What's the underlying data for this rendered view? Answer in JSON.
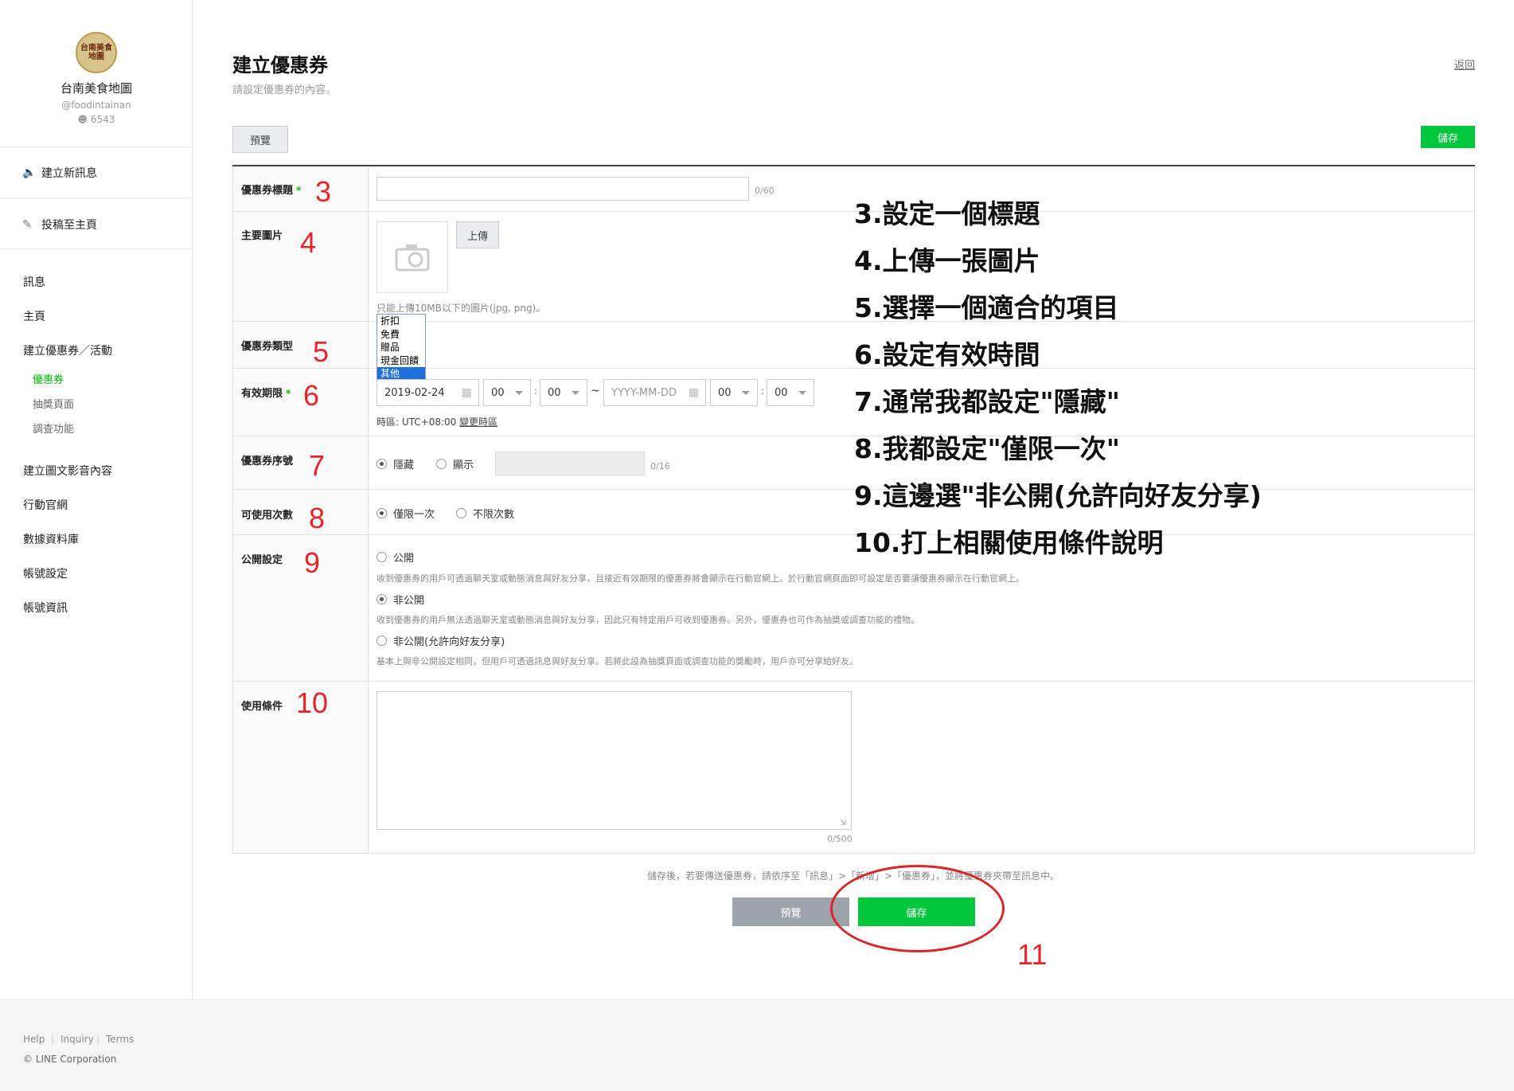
{
  "sidebar": {
    "account_logo_text": "台南美食地圖",
    "account_name": "台南美食地圖",
    "account_id": "@foodintainan",
    "followers": "6543",
    "actions": [
      {
        "label": "建立新訊息",
        "icon": "megaphone-icon"
      },
      {
        "label": "投稿至主頁",
        "icon": "edit-icon"
      }
    ],
    "menu": {
      "messages": "訊息",
      "home": "主頁",
      "coupon_event": "建立優惠券／活動",
      "coupon": "優惠券",
      "lottery": "抽獎頁面",
      "survey": "調查功能",
      "rich_content": "建立圖文影音內容",
      "official_site": "行動官網",
      "database": "數據資料庫",
      "account_settings": "帳號設定",
      "account_info": "帳號資訊"
    }
  },
  "header": {
    "title": "建立優惠券",
    "subtitle": "請設定優惠券的內容。",
    "back": "返回",
    "preview": "預覽",
    "save": "儲存"
  },
  "form": {
    "title_label": "優惠券標題",
    "required_mark": "*",
    "title_counter": "0/60",
    "image_label": "主要圖片",
    "upload": "上傳",
    "image_hint": "只能上傳10MB以下的圖片(jpg, png)。",
    "type_label": "優惠券類型",
    "type_options": [
      "折扣",
      "免費",
      "贈品",
      "現金回饋",
      "其他"
    ],
    "type_selected": "其他",
    "period_label": "有效期限",
    "start_date": "2019-02-24",
    "start_hour": "00",
    "start_min": "00",
    "tilde": "~",
    "colon": ":",
    "end_date_placeholder": "YYYY-MM-DD",
    "end_hour": "00",
    "end_min": "00",
    "timezone": "時區: UTC+08:00",
    "change_timezone": "變更時區",
    "serial_label": "優惠券序號",
    "serial_hide": "隱藏",
    "serial_show": "顯示",
    "serial_counter": "0/16",
    "usage_label": "可使用次數",
    "usage_once": "僅限一次",
    "usage_unlimited": "不限次數",
    "public_label": "公開設定",
    "public": "公開",
    "public_desc": "收到優惠券的用戶可透過聊天室或動態消息與好友分享，且接近有效期限的優惠券將會顯示在行動官網上。於行動官網頁面即可設定是否要讓優惠券顯示在行動官網上。",
    "private": "非公開",
    "private_desc": "收到優惠券的用戶無法透過聊天室或動態消息與好友分享，因此只有特定用戶可收到優惠券。另外，優惠券也可作為抽獎或調查功能的禮物。",
    "private_share": "非公開(允許向好友分享)",
    "private_share_desc": "基本上與非公開設定相同，但用戶可透過訊息與好友分享。若將此設為抽獎頁面或調查功能的獎勵時，用戶亦可分享給好友。",
    "terms_label": "使用條件",
    "terms_counter": "0/500"
  },
  "bottom": {
    "note": "儲存後，若要傳送優惠券，請依序至「訊息」>「新增」>「優惠券」，並將優惠券夾帶至訊息中。",
    "preview": "預覽",
    "save": "儲存"
  },
  "annotations": {
    "n3": "3",
    "n4": "4",
    "n5": "5",
    "n6": "6",
    "n7": "7",
    "n8": "8",
    "n9": "9",
    "n10": "10",
    "n11": "11",
    "steps": [
      "3.設定一個標題",
      "4.上傳一張圖片",
      "5.選擇一個適合的項目",
      "6.設定有效時間",
      "7.通常我都設定\"隱藏\"",
      "8.我都設定\"僅限一次\"",
      "9.這邊選\"非公開(允許向好友分享)",
      "10.打上相關使用條件說明"
    ]
  },
  "footer": {
    "help": "Help",
    "inquiry": "Inquiry",
    "terms": "Terms",
    "sep": "|",
    "copyright": "© LINE Corporation"
  },
  "colors": {
    "accent_green": "#00c73c",
    "annotation_red": "#e8242a"
  }
}
